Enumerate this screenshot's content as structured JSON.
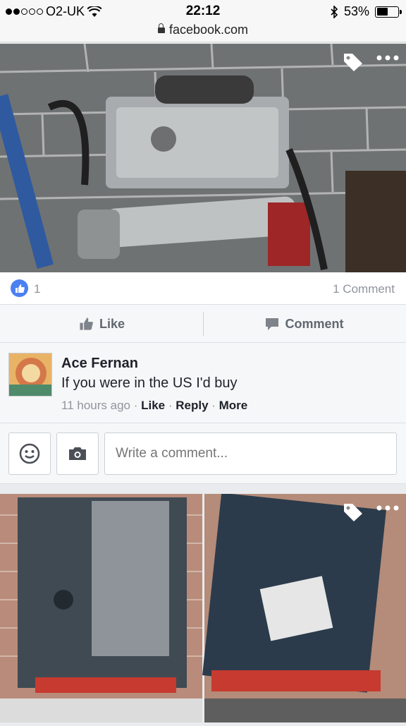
{
  "status": {
    "carrier": "O2-UK",
    "time": "22:12",
    "battery": "53%",
    "battery_level": 0.53
  },
  "url": {
    "domain": "facebook.com"
  },
  "post": {
    "likes": "1",
    "comments_count": "1 Comment",
    "actions": {
      "like": "Like",
      "comment": "Comment"
    }
  },
  "comment": {
    "author": "Ace Fernan",
    "text": "If you were in the US I'd buy",
    "time": "11 hours ago",
    "like": "Like",
    "reply": "Reply",
    "more": "More"
  },
  "composer": {
    "placeholder": "Write a comment..."
  },
  "icons": {
    "tag": "tag-icon",
    "more": "more-icon",
    "like": "thumbs-up-icon",
    "comment": "comment-bubble-icon",
    "emoji": "smiley-icon",
    "camera": "camera-icon"
  }
}
